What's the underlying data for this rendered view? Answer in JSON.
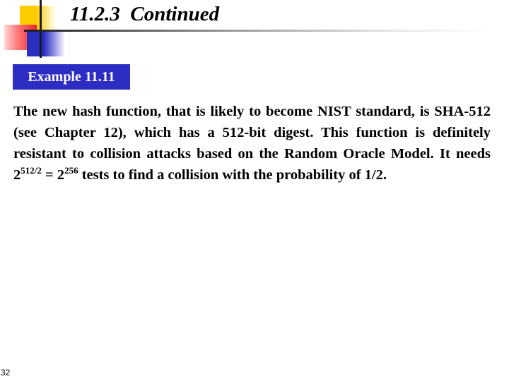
{
  "slide": {
    "title": "11.2.3  Continued",
    "example_label": "Example 11.11",
    "body": {
      "part1": "The new hash function, that is likely to become NIST standard, is SHA-512 (see Chapter 12), which has a 512-bit digest. This function is definitely resistant to collision attacks based on the Random Oracle Model. It needs 2",
      "exp1": "512/2",
      "part2": " = 2",
      "exp2": "256",
      "part3": " tests to find a collision with the probability of 1/2."
    },
    "slide_number": "32"
  },
  "decoration": {
    "colors": {
      "yellow": "#ffcc00",
      "red": "#e8262a",
      "blue": "#2a2fc0",
      "line": "#1a1a2a",
      "badge": "#2d2dc4"
    }
  }
}
